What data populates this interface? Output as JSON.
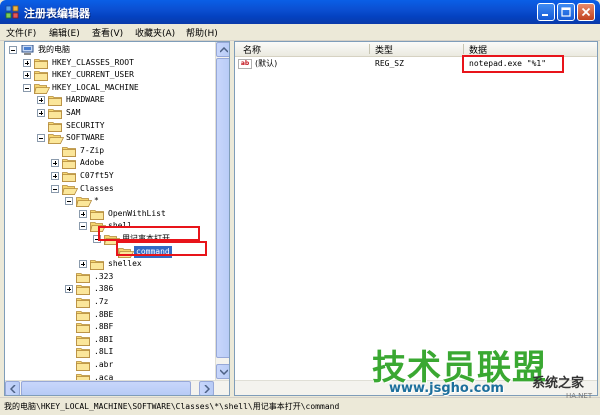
{
  "window": {
    "title": "注册表编辑器"
  },
  "menu": [
    {
      "label": "文件(F)"
    },
    {
      "label": "编辑(E)"
    },
    {
      "label": "查看(V)"
    },
    {
      "label": "收藏夹(A)"
    },
    {
      "label": "帮助(H)"
    }
  ],
  "tree": [
    {
      "label": "我的电脑",
      "expander": "minus",
      "selected": false
    },
    {
      "label": "HKEY_CLASSES_ROOT",
      "expander": "plus",
      "selected": false
    },
    {
      "label": "HKEY_CURRENT_USER",
      "expander": "plus",
      "selected": false
    },
    {
      "label": "HKEY_LOCAL_MACHINE",
      "expander": "minus",
      "selected": false
    },
    {
      "label": "HARDWARE",
      "expander": "plus",
      "selected": false
    },
    {
      "label": "SAM",
      "expander": "plus",
      "selected": false
    },
    {
      "label": "SECURITY",
      "expander": "none",
      "selected": false
    },
    {
      "label": "SOFTWARE",
      "expander": "minus",
      "selected": false
    },
    {
      "label": "7-Zip",
      "expander": "none",
      "selected": false
    },
    {
      "label": "Adobe",
      "expander": "plus",
      "selected": false
    },
    {
      "label": "C07ft5Y",
      "expander": "plus",
      "selected": false
    },
    {
      "label": "Classes",
      "expander": "minus",
      "selected": false
    },
    {
      "label": "*",
      "expander": "minus",
      "selected": false
    },
    {
      "label": "OpenWithList",
      "expander": "plus",
      "selected": false
    },
    {
      "label": "shell",
      "expander": "minus",
      "selected": false
    },
    {
      "label": "用记事本打开",
      "expander": "minus",
      "selected": false
    },
    {
      "label": "command",
      "expander": "none",
      "selected": true
    },
    {
      "label": "shellex",
      "expander": "plus",
      "selected": false
    },
    {
      "label": ".323",
      "expander": "none",
      "selected": false
    },
    {
      "label": ".386",
      "expander": "plus",
      "selected": false
    },
    {
      "label": ".7z",
      "expander": "none",
      "selected": false
    },
    {
      "label": ".8BE",
      "expander": "none",
      "selected": false
    },
    {
      "label": ".8BF",
      "expander": "none",
      "selected": false
    },
    {
      "label": ".8BI",
      "expander": "none",
      "selected": false
    },
    {
      "label": ".8LI",
      "expander": "none",
      "selected": false
    },
    {
      "label": ".abr",
      "expander": "none",
      "selected": false
    },
    {
      "label": ".aca",
      "expander": "none",
      "selected": false
    }
  ],
  "values_table": {
    "columns": [
      "名称",
      "类型",
      "数据"
    ],
    "rows": [
      {
        "name": "(默认)",
        "type": "REG_SZ",
        "data": "notepad.exe \"%1\""
      }
    ]
  },
  "status": {
    "path": "我的电脑\\HKEY_LOCAL_MACHINE\\SOFTWARE\\Classes\\*\\shell\\用记事本打开\\command"
  },
  "watermark": {
    "main": "技术员联盟",
    "url": "www.jsgho.com",
    "side": "系统之家",
    "small": "HA.NET"
  },
  "colors": {
    "titlebar": "#0b4fd2",
    "highlight": "#e8141a",
    "selection": "#316ac5",
    "watermark_green": "#3aa832"
  },
  "icons": {
    "app": "registry-icon",
    "folder": "folder-icon",
    "folder_open": "folder-open-icon",
    "value": "string-value-icon",
    "computer": "computer-icon"
  }
}
